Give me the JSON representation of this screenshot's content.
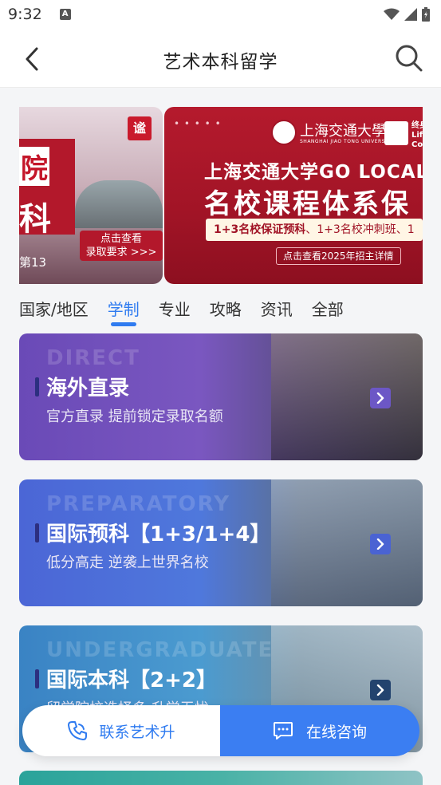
{
  "status_bar": {
    "time": "9:32",
    "notification_letter": "A"
  },
  "nav": {
    "title": "艺术本科留学"
  },
  "banner": {
    "left_card": {
      "logo_text": "谧",
      "headline_char_1": "院",
      "headline_char_2": "科",
      "cta_line_1": "点击查看",
      "cta_line_2": "录取要求 >>>",
      "footer_text": "第13"
    },
    "right_card": {
      "dots": "• • • • •",
      "university_name": "上海交通大學",
      "university_name_en": "SHANGHAI JIAO TONG UNIVERSITY",
      "partner_text": "终身\nLife\nColl",
      "headline": "上海交通大学GO LOCAL",
      "headline_2": "名校课程体系保",
      "pill_bold": "1+3名校保证预科",
      "pill_rest": "、1+3名校冲刺班、1",
      "footer": "点击查看2025年招主详情"
    }
  },
  "tabs": [
    {
      "label": "国家/地区",
      "active": false
    },
    {
      "label": "学制",
      "active": true
    },
    {
      "label": "专业",
      "active": false
    },
    {
      "label": "攻略",
      "active": false
    },
    {
      "label": "资讯",
      "active": false
    },
    {
      "label": "全部",
      "active": false
    }
  ],
  "cards": [
    {
      "eyebrow": "DIRECT",
      "title": "海外直录",
      "subtitle": "官方直录  提前锁定录取名额"
    },
    {
      "eyebrow": "PREPARATORY",
      "title": "国际预科【1+3/1+4】",
      "subtitle": "低分高走  逆袭上世界名校"
    },
    {
      "eyebrow": "UNDERGRADUATE",
      "title": "国际本科【2+2】",
      "subtitle": "留学院校选择多  升学无忧"
    }
  ],
  "bottom_bar": {
    "contact_label": "联系艺术升",
    "consult_label": "在线咨询"
  },
  "colors": {
    "accent": "#2f7bf0",
    "consult_button": "#3b7ef2",
    "banner_red": "#a11426"
  },
  "icons": {
    "back": "chevron-left-icon",
    "search": "search-icon",
    "phone": "phone-icon",
    "chat": "chat-icon",
    "wifi": "wifi-icon",
    "signal": "signal-icon",
    "battery": "battery-icon"
  }
}
